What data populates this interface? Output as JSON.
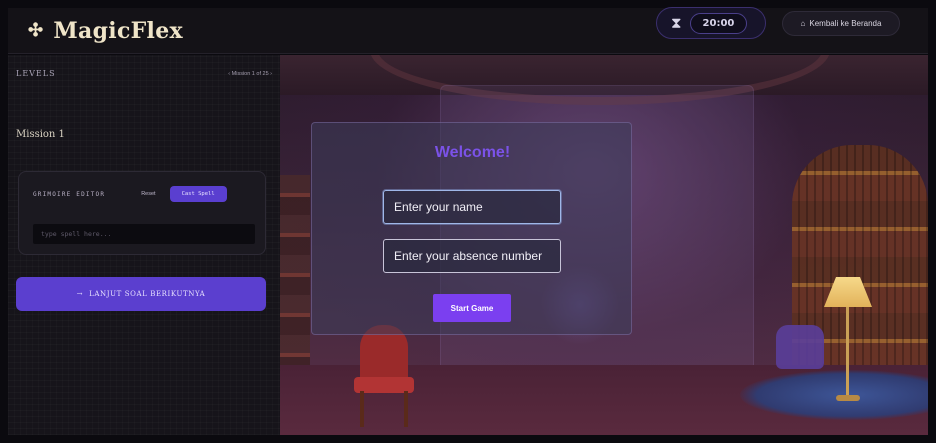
{
  "header": {
    "logo_icon": "sparkle-icon",
    "app_title": "MagicFlex",
    "timer_icon": "hourglass-icon",
    "timer_value": "20:00",
    "home_icon": "home-icon",
    "home_label": "Kembali ke Beranda"
  },
  "sidebar": {
    "levels_title": "LEVELS",
    "mission_nav": "‹ Mission 1 of 25 ›",
    "mission_title": "Mission 1",
    "grimoire": {
      "title": "GRIMOIRE EDITOR",
      "reset_label": "Reset",
      "cast_label": "Cast Spell",
      "input_placeholder": "type spell here..."
    },
    "next_arrow": "→",
    "next_label": "LANJUT SOAL BERIKUTNYA"
  },
  "modal": {
    "title": "Welcome!",
    "name_placeholder": "Enter your name",
    "absence_placeholder": "Enter your absence number",
    "start_label": "Start Game"
  },
  "colors": {
    "accent": "#5b3fcf",
    "modal_title": "#7b52e8",
    "start_button": "#7b3ff0"
  }
}
